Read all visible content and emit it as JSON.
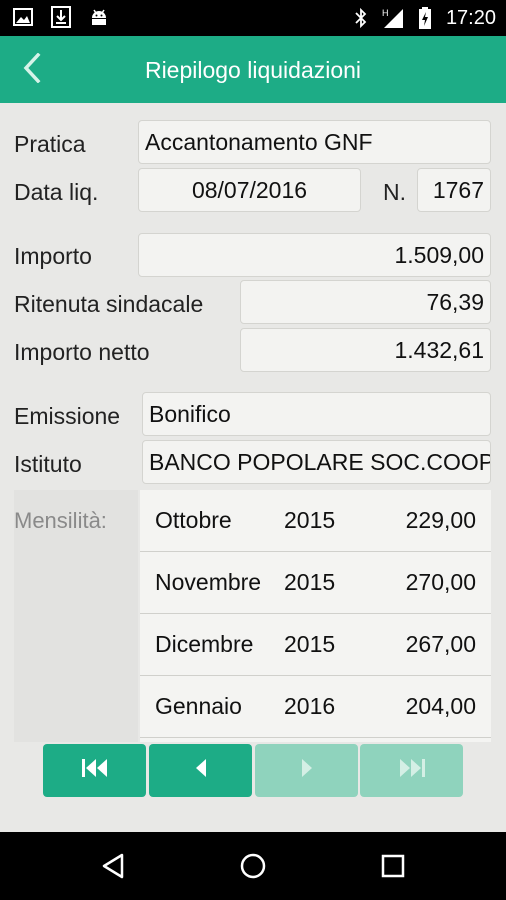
{
  "status_bar": {
    "time": "17:20",
    "left_icons": [
      "image-icon",
      "download-icon",
      "android-icon"
    ],
    "right_icons": [
      "bluetooth-icon",
      "signal-icon",
      "battery-charging-icon"
    ]
  },
  "app_bar": {
    "title": "Riepilogo liquidazioni",
    "back_icon": "chevron-left-icon",
    "color": "#1dac86"
  },
  "form": {
    "pratica_label": "Pratica",
    "pratica_value": "Accantonamento GNF",
    "data_liq_label": "Data liq.",
    "data_liq_value": "08/07/2016",
    "numero_label": "N.",
    "numero_value": "1767",
    "importo_label": "Importo",
    "importo_value": "1.509,00",
    "ritenuta_label": "Ritenuta sindacale",
    "ritenuta_value": "76,39",
    "netto_label": "Importo netto",
    "netto_value": "1.432,61",
    "emissione_label": "Emissione",
    "emissione_value": "Bonifico",
    "istituto_label": "Istituto",
    "istituto_value": "BANCO POPOLARE SOC.COOP"
  },
  "mensilita": {
    "label": "Mensilità:",
    "rows": [
      {
        "mese": "Ottobre",
        "anno": "2015",
        "importo": "229,00"
      },
      {
        "mese": "Novembre",
        "anno": "2015",
        "importo": "270,00"
      },
      {
        "mese": "Dicembre",
        "anno": "2015",
        "importo": "267,00"
      },
      {
        "mese": "Gennaio",
        "anno": "2016",
        "importo": "204,00"
      }
    ]
  },
  "nav_buttons": [
    {
      "icon": "first-icon",
      "enabled": true
    },
    {
      "icon": "previous-icon",
      "enabled": true
    },
    {
      "icon": "next-icon",
      "enabled": false
    },
    {
      "icon": "last-icon",
      "enabled": false
    }
  ],
  "system_nav": [
    "back-triangle-icon",
    "home-circle-icon",
    "recents-square-icon"
  ]
}
